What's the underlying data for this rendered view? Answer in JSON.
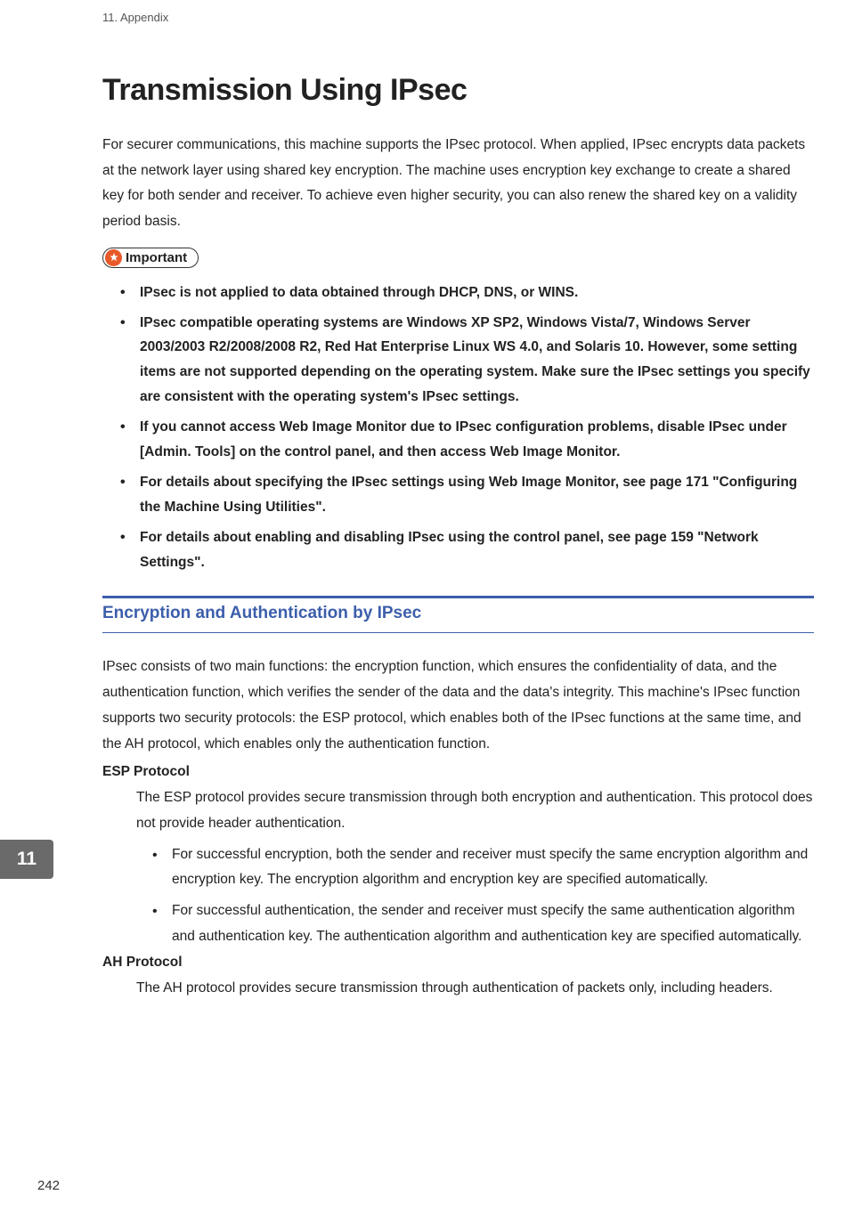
{
  "header": {
    "chapter_label": "11. Appendix"
  },
  "title": "Transmission Using IPsec",
  "intro": "For securer communications, this machine supports the IPsec protocol. When applied, IPsec encrypts data packets at the network layer using shared key encryption. The machine uses encryption key exchange to create a shared key for both sender and receiver. To achieve even higher security, you can also renew the shared key on a validity period basis.",
  "important": {
    "label": "Important",
    "items": [
      "IPsec is not applied to data obtained through DHCP, DNS, or WINS.",
      "IPsec compatible operating systems are Windows XP SP2, Windows Vista/7, Windows Server 2003/2003 R2/2008/2008 R2, Red Hat Enterprise Linux WS 4.0, and Solaris 10. However, some setting items are not supported depending on the operating system. Make sure the IPsec settings you specify are consistent with the operating system's IPsec settings.",
      "If you cannot access Web Image Monitor due to IPsec configuration problems, disable IPsec under [Admin. Tools] on the control panel, and then access Web Image Monitor.",
      "For details about specifying the IPsec settings using Web Image Monitor, see page 171 \"Configuring the Machine Using Utilities\".",
      "For details about enabling and disabling IPsec using the control panel, see page 159 \"Network Settings\"."
    ]
  },
  "section": {
    "heading": "Encryption and Authentication by IPsec",
    "intro": "IPsec consists of two main functions: the encryption function, which ensures the confidentiality of data, and the authentication function, which verifies the sender of the data and the data's integrity. This machine's IPsec function supports two security protocols: the ESP protocol, which enables both of the IPsec functions at the same time, and the AH protocol, which enables only the authentication function.",
    "esp": {
      "title": "ESP Protocol",
      "desc": "The ESP protocol provides secure transmission through both encryption and authentication. This protocol does not provide header authentication.",
      "bullets": [
        "For successful encryption, both the sender and receiver must specify the same encryption algorithm and encryption key. The encryption algorithm and encryption key are specified automatically.",
        "For successful authentication, the sender and receiver must specify the same authentication algorithm and authentication key. The authentication algorithm and authentication key are specified automatically."
      ]
    },
    "ah": {
      "title": "AH Protocol",
      "desc": "The AH protocol provides secure transmission through authentication of packets only, including headers."
    }
  },
  "chapter_tab": "11",
  "page_number": "242"
}
